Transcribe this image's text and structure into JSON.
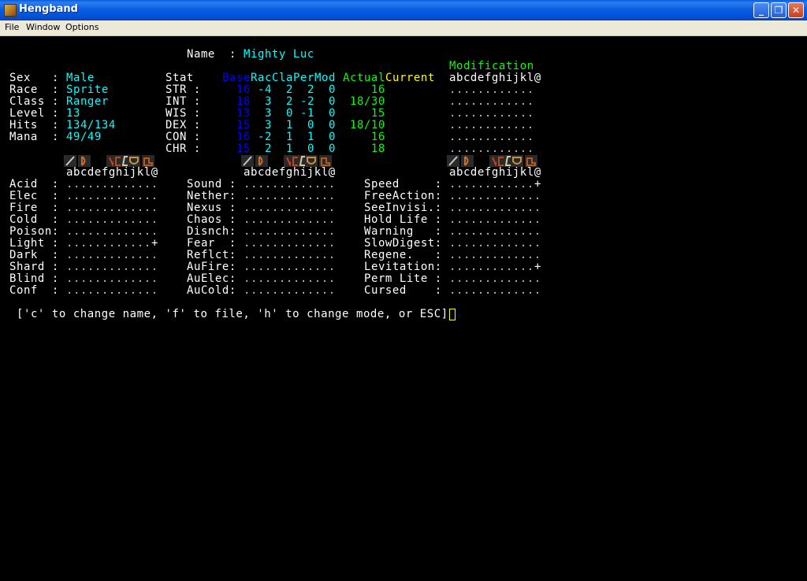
{
  "window": {
    "title": "Hengband",
    "menu": [
      "File",
      "Window",
      "Options"
    ],
    "controls": {
      "minimize": "_",
      "restore": "❐",
      "close": "✕"
    }
  },
  "character": {
    "name_label": "Name",
    "name": "Mighty Luc",
    "info": [
      {
        "label": "Sex",
        "value": "Male"
      },
      {
        "label": "Race",
        "value": "Sprite"
      },
      {
        "label": "Class",
        "value": "Ranger"
      },
      {
        "label": "Level",
        "value": "13"
      },
      {
        "label": "Hits",
        "value": "134/134"
      },
      {
        "label": "Mana",
        "value": "49/49"
      }
    ]
  },
  "stats": {
    "headers": {
      "stat": "Stat",
      "base": "Base",
      "rac": "Rac",
      "cla": "Cla",
      "per": "Per",
      "mod": "Mod",
      "actual": "Actual",
      "current": "Current"
    },
    "rows": [
      {
        "name": "STR",
        "base": "16",
        "rac": "-4",
        "cla": "2",
        "per": "2",
        "mod": "0",
        "actual": "16"
      },
      {
        "name": "INT",
        "base": "18",
        "rac": "3",
        "cla": "2",
        "per": "-2",
        "mod": "0",
        "actual": "18/30"
      },
      {
        "name": "WIS",
        "base": "13",
        "rac": "3",
        "cla": "0",
        "per": "-1",
        "mod": "0",
        "actual": "15"
      },
      {
        "name": "DEX",
        "base": "15",
        "rac": "3",
        "cla": "1",
        "per": "0",
        "mod": "0",
        "actual": "18/10"
      },
      {
        "name": "CON",
        "base": "16",
        "rac": "-2",
        "cla": "1",
        "per": "1",
        "mod": "0",
        "actual": "16"
      },
      {
        "name": "CHR",
        "base": "15",
        "rac": "2",
        "cla": "1",
        "per": "0",
        "mod": "0",
        "actual": "18"
      }
    ],
    "modification_title": "Modification",
    "slot_letters": "abcdefghijkl@",
    "modification_rows": [
      "............",
      "............",
      "............",
      "............",
      "............",
      "............"
    ]
  },
  "equipment_icons": [
    {
      "slot": "a",
      "icon": "sword-icon"
    },
    {
      "slot": "c",
      "icon": "bow-icon"
    },
    {
      "slot": "g",
      "icon": "amulet-icon"
    },
    {
      "slot": "h",
      "icon": "armor-icon"
    },
    {
      "slot": "i",
      "icon": "cloak-icon"
    },
    {
      "slot": "j",
      "icon": "shield-icon"
    },
    {
      "slot": "l",
      "icon": "boots-icon"
    }
  ],
  "resistances": {
    "columns": [
      {
        "letters": "abcdefghijkl@",
        "rows": [
          {
            "label": "Acid  :",
            "flags": "............."
          },
          {
            "label": "Elec  :",
            "flags": "............."
          },
          {
            "label": "Fire  :",
            "flags": "............."
          },
          {
            "label": "Cold  :",
            "flags": "............."
          },
          {
            "label": "Poison:",
            "flags": "............."
          },
          {
            "label": "Light :",
            "flags": "............+"
          },
          {
            "label": "Dark  :",
            "flags": "............."
          },
          {
            "label": "Shard :",
            "flags": "............."
          },
          {
            "label": "Blind :",
            "flags": "............."
          },
          {
            "label": "Conf  :",
            "flags": "............."
          }
        ]
      },
      {
        "letters": "abcdefghijkl@",
        "rows": [
          {
            "label": "Sound :",
            "flags": "............."
          },
          {
            "label": "Nether:",
            "flags": "............."
          },
          {
            "label": "Nexus :",
            "flags": "............."
          },
          {
            "label": "Chaos :",
            "flags": "............."
          },
          {
            "label": "Disnch:",
            "flags": "............."
          },
          {
            "label": "Fear  :",
            "flags": "............."
          },
          {
            "label": "Reflct:",
            "flags": "............."
          },
          {
            "label": "AuFire:",
            "flags": "............."
          },
          {
            "label": "AuElec:",
            "flags": "............."
          },
          {
            "label": "AuCold:",
            "flags": "............."
          }
        ]
      },
      {
        "letters": "abcdefghijkl@",
        "rows": [
          {
            "label": "Speed     :",
            "flags": "............+"
          },
          {
            "label": "FreeAction:",
            "flags": "............."
          },
          {
            "label": "SeeInvisi.:",
            "flags": "............."
          },
          {
            "label": "Hold Life :",
            "flags": "............."
          },
          {
            "label": "Warning   :",
            "flags": "............."
          },
          {
            "label": "SlowDigest:",
            "flags": "............."
          },
          {
            "label": "Regene.   :",
            "flags": "............."
          },
          {
            "label": "Levitation:",
            "flags": "............+"
          },
          {
            "label": "Perm Lite :",
            "flags": "............."
          },
          {
            "label": "Cursed    :",
            "flags": "............."
          }
        ]
      }
    ]
  },
  "prompt": "['c' to change name, 'f' to file, 'h' to change mode, or ESC]"
}
